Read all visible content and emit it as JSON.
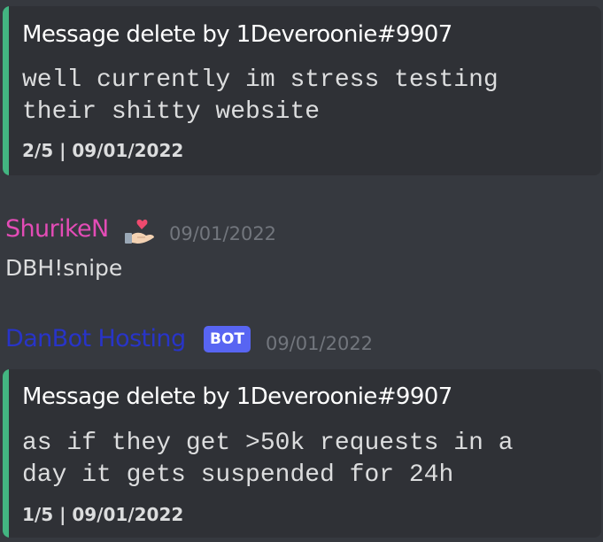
{
  "colors": {
    "background": "#36393f",
    "embed_background": "#2f3136",
    "embed_accent": "#43b581",
    "shuriken_name": "#e34cb6",
    "danbot_name": "#2834c8",
    "bot_tag": "#5865f2",
    "timestamp": "#72767d"
  },
  "embed_top": {
    "title": "Message delete by 1Deveroonie#9907",
    "description_lines": [
      "well currently im stress testing",
      "their shitty website"
    ],
    "footer": "2/5 | 09/01/2022"
  },
  "message": {
    "author": "ShurikeN",
    "author_icon": "heart-in-hand-emoji",
    "timestamp": "09/01/2022",
    "content": "DBH!snipe"
  },
  "bot_message": {
    "author": "DanBot Hosting",
    "tag": "BOT",
    "timestamp": "09/01/2022"
  },
  "embed_bottom": {
    "title": "Message delete by 1Deveroonie#9907",
    "description_lines": [
      "as if they get >50k requests in a",
      "day it gets suspended for 24h"
    ],
    "footer": "1/5 | 09/01/2022"
  }
}
